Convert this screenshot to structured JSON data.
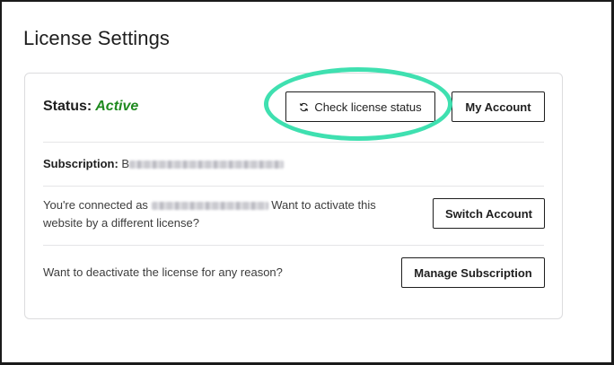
{
  "page": {
    "title": "License Settings"
  },
  "status": {
    "label": "Status:",
    "value": "Active",
    "value_color": "#1f8a1f"
  },
  "toolbar": {
    "check_label": "Check license status",
    "account_label": "My Account"
  },
  "subscription": {
    "label": "Subscription:",
    "value_visible_prefix": "B"
  },
  "connected": {
    "prefix": "You're connected as",
    "suffix_line1": "Want to activate this",
    "line2": "website by a different license?",
    "button_label": "Switch Account"
  },
  "deactivate": {
    "text": "Want to deactivate the license for any reason?",
    "button_label": "Manage Subscription"
  },
  "colors": {
    "highlight": "#3fe0b0",
    "border": "#dcdcde"
  },
  "icons": {
    "check_button_icon": "refresh-icon"
  }
}
